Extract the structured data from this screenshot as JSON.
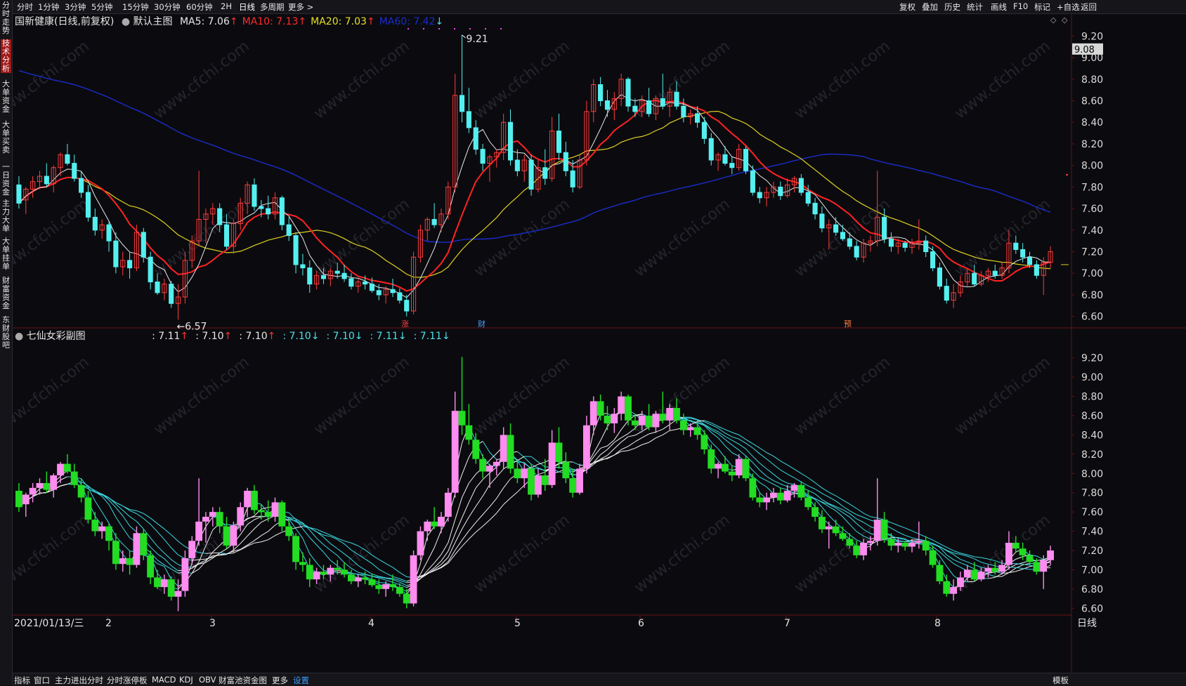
{
  "topbar": {
    "periods": [
      "分时",
      "1分钟",
      "3分钟",
      "5分钟",
      "15分钟",
      "30分钟",
      "60分钟",
      "2H",
      "日线",
      "多周期",
      "更多 >"
    ],
    "active_period": "日线",
    "right_tools": [
      "复权",
      "叠加",
      "历史",
      "统计",
      "画线",
      "F10",
      "标记",
      "+自选",
      "返回"
    ]
  },
  "sidebar": {
    "tabs": [
      "分时走势",
      "技术分析",
      "大单资金",
      "大单买卖",
      "一日资金",
      "主力大单",
      "大单挂单",
      "财富资金",
      "东财股吧"
    ],
    "active": "技术分析"
  },
  "main": {
    "title": "国新健康(日线,前复权)",
    "template": "默认主图",
    "ma": [
      {
        "label": "MA5: 7.06",
        "arrow": "↑",
        "color": "#e8e8e8"
      },
      {
        "label": "MA10: 7.13",
        "arrow": "↑",
        "color": "#ff2a2a"
      },
      {
        "label": "MA20: 7.03",
        "arrow": "↑",
        "color": "#e8e020"
      },
      {
        "label": "MA60: 7.42",
        "arrow": "↓",
        "color": "#1a2ccc"
      }
    ],
    "price_tag": "9.08",
    "high_label": "9.21",
    "low_label": "6.57",
    "event_markers": [
      "涨",
      "财",
      "预"
    ]
  },
  "sub": {
    "title": "七仙女彩副图",
    "values": [
      {
        "label": ": 7.11",
        "arrow": "↑",
        "color": "#e8e8e8",
        "arrow_color": "#ff3030"
      },
      {
        "label": ": 7.10",
        "arrow": "↑",
        "color": "#e8e8e8",
        "arrow_color": "#ff3030"
      },
      {
        "label": ": 7.10",
        "arrow": "↑",
        "color": "#e8e8e8",
        "arrow_color": "#ff3030"
      },
      {
        "label": ": 7.10",
        "arrow": "↓",
        "color": "#4de0e8",
        "arrow_color": "#4de0e8"
      },
      {
        "label": ": 7.10",
        "arrow": "↓",
        "color": "#4de0e8",
        "arrow_color": "#4de0e8"
      },
      {
        "label": ": 7.11",
        "arrow": "↓",
        "color": "#4de0e8",
        "arrow_color": "#4de0e8"
      },
      {
        "label": ": 7.11",
        "arrow": "↓",
        "color": "#4de0e8",
        "arrow_color": "#4de0e8"
      }
    ]
  },
  "xaxis": {
    "first_date": "2021/01/13/三",
    "months": [
      "2",
      "3",
      "4",
      "5",
      "6",
      "7",
      "8"
    ],
    "period_label": "日线"
  },
  "bottombar": {
    "left": [
      "指标",
      "窗口"
    ],
    "indicators": [
      "主力进出分时",
      "分时涨停板",
      "MACD",
      "KDJ",
      "OBV",
      "财富池资金图",
      "更多"
    ],
    "settings": "设置",
    "right": "模板"
  },
  "watermark": "www.cfchi.com",
  "colors": {
    "bg": "#0b0b0f",
    "up": "#ff3b3b",
    "down": "#54f0f0",
    "sub_up": "#ff8cf0",
    "sub_down": "#22dd22",
    "ma5": "#e8e8e8",
    "ma10": "#ff2222",
    "ma20": "#e0d020",
    "ma60": "#1a2ccc",
    "ribbon": "#3ad8e0"
  },
  "chart_data": [
    {
      "type": "candlestick",
      "title": "国新健康(日线,前复权)",
      "ylim": [
        6.5,
        9.3
      ],
      "yticks": [
        6.6,
        6.8,
        7.0,
        7.2,
        7.4,
        7.6,
        7.8,
        8.0,
        8.2,
        8.4,
        8.6,
        8.8,
        9.0,
        9.2
      ],
      "x_month_labels": [
        "2021/01/13/三",
        "2",
        "3",
        "4",
        "5",
        "6",
        "7",
        "8"
      ],
      "ohlc": [
        [
          7.82,
          7.9,
          7.6,
          7.65
        ],
        [
          7.68,
          7.8,
          7.55,
          7.78
        ],
        [
          7.78,
          7.9,
          7.7,
          7.85
        ],
        [
          7.85,
          7.95,
          7.78,
          7.9
        ],
        [
          7.9,
          8.02,
          7.8,
          7.83
        ],
        [
          7.83,
          8.0,
          7.75,
          7.98
        ],
        [
          7.98,
          8.12,
          7.9,
          8.1
        ],
        [
          8.1,
          8.2,
          8.0,
          8.02
        ],
        [
          8.02,
          8.1,
          7.85,
          7.88
        ],
        [
          7.88,
          7.95,
          7.7,
          7.75
        ],
        [
          7.75,
          7.82,
          7.48,
          7.52
        ],
        [
          7.52,
          7.6,
          7.35,
          7.4
        ],
        [
          7.4,
          7.5,
          7.32,
          7.45
        ],
        [
          7.45,
          7.48,
          7.2,
          7.3
        ],
        [
          7.3,
          7.38,
          7.0,
          7.06
        ],
        [
          7.06,
          7.2,
          6.98,
          7.12
        ],
        [
          7.12,
          7.2,
          6.95,
          7.05
        ],
        [
          7.05,
          7.45,
          7.02,
          7.38
        ],
        [
          7.38,
          7.42,
          7.1,
          7.15
        ],
        [
          7.15,
          7.2,
          6.85,
          6.92
        ],
        [
          6.92,
          7.0,
          6.8,
          6.82
        ],
        [
          6.82,
          6.95,
          6.75,
          6.9
        ],
        [
          6.9,
          6.93,
          6.68,
          6.72
        ],
        [
          6.72,
          6.9,
          6.57,
          6.78
        ],
        [
          6.78,
          7.2,
          6.72,
          7.12
        ],
        [
          7.12,
          7.35,
          7.05,
          7.3
        ],
        [
          7.3,
          7.95,
          7.25,
          7.5
        ],
        [
          7.5,
          7.6,
          7.28,
          7.55
        ],
        [
          7.55,
          7.65,
          7.45,
          7.6
        ],
        [
          7.6,
          7.65,
          7.38,
          7.45
        ],
        [
          7.45,
          7.55,
          7.22,
          7.25
        ],
        [
          7.25,
          7.5,
          7.18,
          7.46
        ],
        [
          7.46,
          7.7,
          7.4,
          7.65
        ],
        [
          7.65,
          7.85,
          7.55,
          7.82
        ],
        [
          7.82,
          7.88,
          7.58,
          7.62
        ],
        [
          7.62,
          7.68,
          7.52,
          7.6
        ],
        [
          7.6,
          7.72,
          7.5,
          7.55
        ],
        [
          7.55,
          7.75,
          7.5,
          7.7
        ],
        [
          7.7,
          7.72,
          7.4,
          7.45
        ],
        [
          7.45,
          7.52,
          7.3,
          7.35
        ],
        [
          7.35,
          7.38,
          7.0,
          7.08
        ],
        [
          7.08,
          7.18,
          6.98,
          7.05
        ],
        [
          7.05,
          7.12,
          6.82,
          6.9
        ],
        [
          6.9,
          7.02,
          6.85,
          6.98
        ],
        [
          6.98,
          7.05,
          6.9,
          6.95
        ],
        [
          6.95,
          7.05,
          6.88,
          7.02
        ],
        [
          7.02,
          7.1,
          6.95,
          7.0
        ],
        [
          7.0,
          7.08,
          6.92,
          6.95
        ],
        [
          6.95,
          7.0,
          6.85,
          6.88
        ],
        [
          6.88,
          6.95,
          6.82,
          6.92
        ],
        [
          6.92,
          6.98,
          6.85,
          6.9
        ],
        [
          6.9,
          6.96,
          6.82,
          6.84
        ],
        [
          6.84,
          6.9,
          6.75,
          6.8
        ],
        [
          6.8,
          6.88,
          6.72,
          6.85
        ],
        [
          6.85,
          6.95,
          6.78,
          6.82
        ],
        [
          6.82,
          6.86,
          6.72,
          6.75
        ],
        [
          6.75,
          6.8,
          6.6,
          6.65
        ],
        [
          6.65,
          7.2,
          6.62,
          7.15
        ],
        [
          7.15,
          7.45,
          7.1,
          7.4
        ],
        [
          7.4,
          7.52,
          7.3,
          7.5
        ],
        [
          7.5,
          7.65,
          7.42,
          7.45
        ],
        [
          7.45,
          7.6,
          7.38,
          7.55
        ],
        [
          7.55,
          7.85,
          7.5,
          7.8
        ],
        [
          7.8,
          8.85,
          7.75,
          8.65
        ],
        [
          8.65,
          9.21,
          8.4,
          8.5
        ],
        [
          8.5,
          8.72,
          8.3,
          8.35
        ],
        [
          8.35,
          8.42,
          8.1,
          8.15
        ],
        [
          8.15,
          8.2,
          7.95,
          8.02
        ],
        [
          8.02,
          8.1,
          7.85,
          8.08
        ],
        [
          8.08,
          8.15,
          7.98,
          8.12
        ],
        [
          8.12,
          8.48,
          8.05,
          8.4
        ],
        [
          8.4,
          8.52,
          8.0,
          8.05
        ],
        [
          8.05,
          8.15,
          7.9,
          7.95
        ],
        [
          7.95,
          8.1,
          7.85,
          8.05
        ],
        [
          8.05,
          8.1,
          7.72,
          7.78
        ],
        [
          7.78,
          8.05,
          7.75,
          7.98
        ],
        [
          7.98,
          8.15,
          7.82,
          7.88
        ],
        [
          7.88,
          8.45,
          7.85,
          8.32
        ],
        [
          8.32,
          8.48,
          8.05,
          8.12
        ],
        [
          8.12,
          8.22,
          7.9,
          7.95
        ],
        [
          7.95,
          8.05,
          7.75,
          7.8
        ],
        [
          7.8,
          8.1,
          7.78,
          8.05
        ],
        [
          8.05,
          8.6,
          8.0,
          8.5
        ],
        [
          8.5,
          8.8,
          8.4,
          8.75
        ],
        [
          8.75,
          8.82,
          8.55,
          8.6
        ],
        [
          8.6,
          8.7,
          8.45,
          8.52
        ],
        [
          8.52,
          8.68,
          8.42,
          8.62
        ],
        [
          8.62,
          8.85,
          8.55,
          8.8
        ],
        [
          8.8,
          8.82,
          8.5,
          8.55
        ],
        [
          8.55,
          8.62,
          8.45,
          8.5
        ],
        [
          8.5,
          8.65,
          8.45,
          8.6
        ],
        [
          8.6,
          8.72,
          8.45,
          8.48
        ],
        [
          8.48,
          8.65,
          8.42,
          8.62
        ],
        [
          8.62,
          8.85,
          8.52,
          8.55
        ],
        [
          8.55,
          8.72,
          8.45,
          8.68
        ],
        [
          8.68,
          8.78,
          8.52,
          8.55
        ],
        [
          8.55,
          8.62,
          8.4,
          8.45
        ],
        [
          8.45,
          8.52,
          8.38,
          8.48
        ],
        [
          8.48,
          8.55,
          8.35,
          8.4
        ],
        [
          8.4,
          8.45,
          8.2,
          8.25
        ],
        [
          8.25,
          8.3,
          8.0,
          8.05
        ],
        [
          8.05,
          8.12,
          7.95,
          8.1
        ],
        [
          8.1,
          8.18,
          8.0,
          8.02
        ],
        [
          8.02,
          8.08,
          7.92,
          7.98
        ],
        [
          7.98,
          8.2,
          7.95,
          8.15
        ],
        [
          8.15,
          8.18,
          7.92,
          7.95
        ],
        [
          7.95,
          8.0,
          7.72,
          7.75
        ],
        [
          7.75,
          7.8,
          7.65,
          7.7
        ],
        [
          7.7,
          7.8,
          7.62,
          7.75
        ],
        [
          7.75,
          7.85,
          7.7,
          7.8
        ],
        [
          7.8,
          7.85,
          7.68,
          7.72
        ],
        [
          7.72,
          7.88,
          7.7,
          7.82
        ],
        [
          7.82,
          7.9,
          7.75,
          7.88
        ],
        [
          7.88,
          7.92,
          7.72,
          7.75
        ],
        [
          7.75,
          7.82,
          7.62,
          7.65
        ],
        [
          7.65,
          7.7,
          7.5,
          7.55
        ],
        [
          7.55,
          7.62,
          7.38,
          7.42
        ],
        [
          7.42,
          7.5,
          7.22,
          7.45
        ],
        [
          7.45,
          7.52,
          7.35,
          7.38
        ],
        [
          7.38,
          7.45,
          7.3,
          7.32
        ],
        [
          7.32,
          7.38,
          7.22,
          7.25
        ],
        [
          7.25,
          7.3,
          7.12,
          7.15
        ],
        [
          7.15,
          7.32,
          7.1,
          7.28
        ],
        [
          7.28,
          7.35,
          7.2,
          7.3
        ],
        [
          7.3,
          7.95,
          7.25,
          7.52
        ],
        [
          7.52,
          7.6,
          7.28,
          7.32
        ],
        [
          7.32,
          7.38,
          7.2,
          7.25
        ],
        [
          7.25,
          7.32,
          7.18,
          7.28
        ],
        [
          7.28,
          7.3,
          7.2,
          7.24
        ],
        [
          7.24,
          7.32,
          7.18,
          7.28
        ],
        [
          7.28,
          7.5,
          7.22,
          7.3
        ],
        [
          7.3,
          7.35,
          7.15,
          7.2
        ],
        [
          7.2,
          7.25,
          7.02,
          7.05
        ],
        [
          7.05,
          7.1,
          6.85,
          6.88
        ],
        [
          6.88,
          6.95,
          6.72,
          6.75
        ],
        [
          6.75,
          6.9,
          6.68,
          6.82
        ],
        [
          6.82,
          6.98,
          6.78,
          6.92
        ],
        [
          6.92,
          7.05,
          6.88,
          7.0
        ],
        [
          7.0,
          7.08,
          6.88,
          6.9
        ],
        [
          6.9,
          7.02,
          6.88,
          6.98
        ],
        [
          6.98,
          7.05,
          6.92,
          7.02
        ],
        [
          7.02,
          7.08,
          6.95,
          6.98
        ],
        [
          6.98,
          7.1,
          6.95,
          7.05
        ],
        [
          7.05,
          7.4,
          7.0,
          7.28
        ],
        [
          7.28,
          7.35,
          7.18,
          7.22
        ],
        [
          7.22,
          7.28,
          7.1,
          7.15
        ],
        [
          7.15,
          7.2,
          7.05,
          7.08
        ],
        [
          7.08,
          7.12,
          6.95,
          6.98
        ],
        [
          6.98,
          7.15,
          6.8,
          7.1
        ],
        [
          7.1,
          7.25,
          7.05,
          7.2
        ]
      ],
      "series": [
        {
          "name": "MA5",
          "last": 7.06
        },
        {
          "name": "MA10",
          "last": 7.13
        },
        {
          "name": "MA20",
          "last": 7.03
        },
        {
          "name": "MA60",
          "last": 7.42
        }
      ],
      "annotations": [
        {
          "text": "9.21",
          "kind": "high"
        },
        {
          "text": "6.57",
          "kind": "low"
        }
      ]
    },
    {
      "type": "candlestick",
      "title": "七仙女彩副图",
      "ylim": [
        6.5,
        9.3
      ],
      "yticks": [
        6.6,
        6.8,
        7.0,
        7.2,
        7.4,
        7.6,
        7.8,
        8.0,
        8.2,
        8.4,
        8.6,
        8.8,
        9.0,
        9.2
      ],
      "ribbon_periods": [
        3,
        5,
        8,
        10,
        12,
        15,
        18
      ]
    }
  ]
}
